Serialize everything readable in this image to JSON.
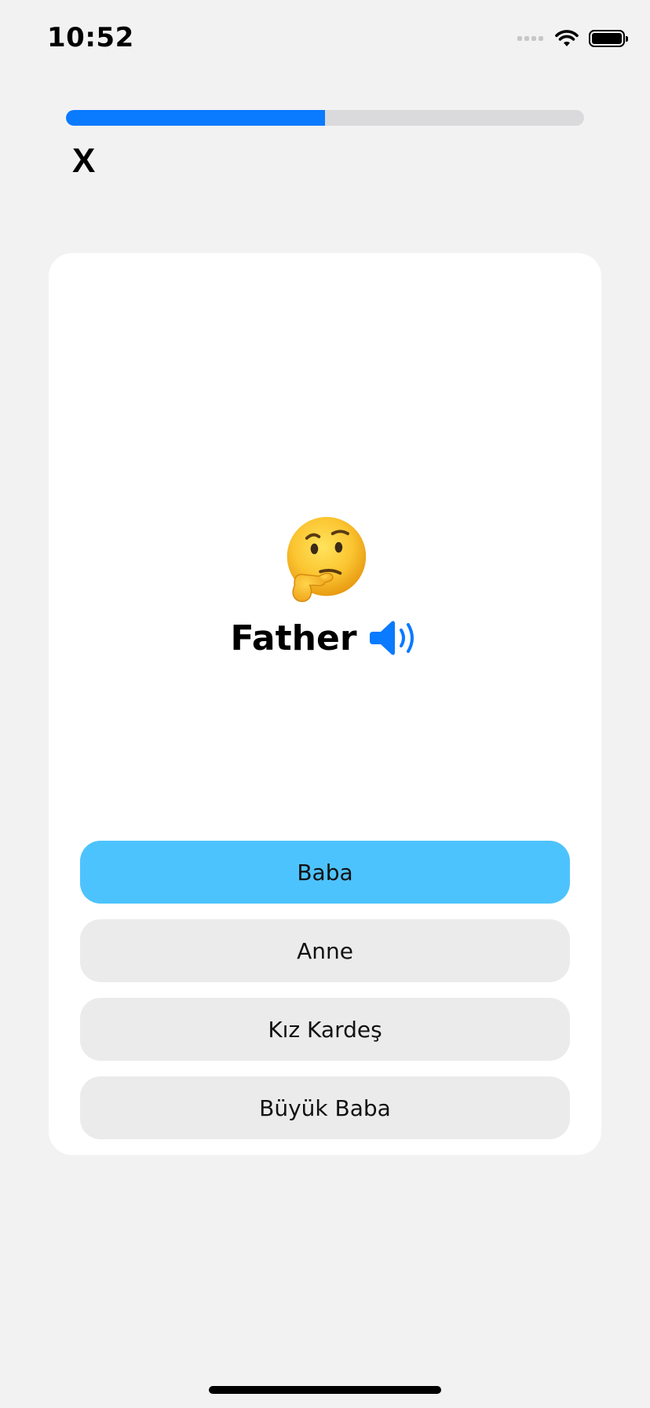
{
  "status_bar": {
    "time": "10:52",
    "icons": [
      "cellular-signal-icon",
      "wifi-icon",
      "battery-icon"
    ]
  },
  "progress": {
    "fraction": 0.5,
    "fill_color": "#0a7aff",
    "track_color": "#dadadc"
  },
  "close_button": {
    "label": "X"
  },
  "question": {
    "emoji": "thinking-face-icon",
    "word": "Father",
    "audio_icon": "speaker-icon"
  },
  "options": [
    {
      "label": "Baba",
      "selected": true
    },
    {
      "label": "Anne",
      "selected": false
    },
    {
      "label": "Kız Kardeş",
      "selected": false
    },
    {
      "label": "Büyük Baba",
      "selected": false
    }
  ],
  "colors": {
    "background": "#f2f2f2",
    "card": "#ffffff",
    "option_default": "#ebebeb",
    "option_selected": "#4dc3fd",
    "accent": "#0a7aff"
  }
}
